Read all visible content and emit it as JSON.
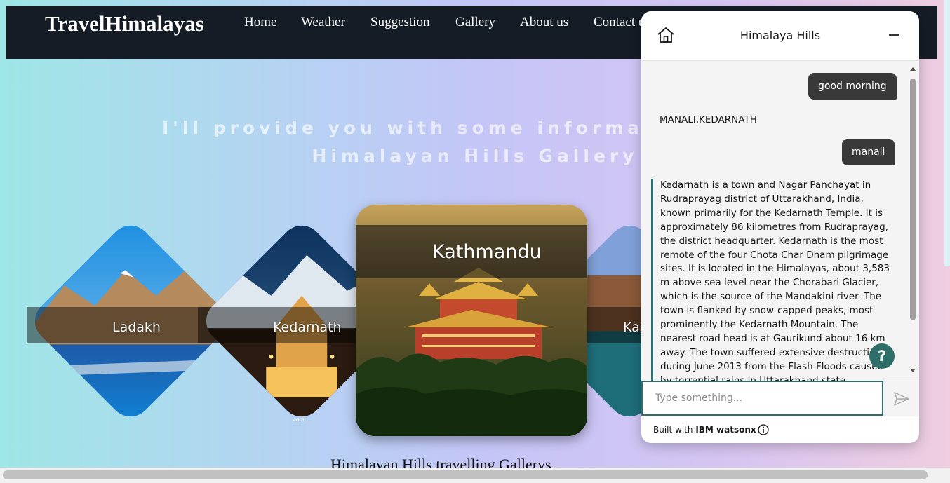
{
  "site": {
    "brand": "TravelHimalayas",
    "nav": [
      "Home",
      "Weather",
      "Suggestion",
      "Gallery",
      "About us",
      "Contact us"
    ]
  },
  "hero": {
    "line1": "I'll provide you with some information about",
    "line2": "Himalayan Hills Gallery"
  },
  "gallery": {
    "cards": [
      "Ladakh",
      "Kedarnath",
      "Kathmandu",
      "Kashmir"
    ],
    "watermark": "com",
    "caption": "Himalayan Hills travelling Gallerys"
  },
  "chat": {
    "title": "Himalaya Hills",
    "messages": [
      {
        "from": "user",
        "text": "good morning"
      },
      {
        "from": "bot",
        "text": "MANALI,KEDARNATH"
      },
      {
        "from": "user",
        "text": "manali"
      },
      {
        "from": "bot",
        "text": "Kedarnath is a town and Nagar Panchayat in Rudraprayag district of Uttarakhand, India, known primarily for the Kedarnath Temple. It is approximately 86 kilometres from Rudraprayag, the district headquarter. Kedarnath is the most remote of the four Chota Char Dham pilgrimage sites. It is located in the Himalayas, about 3,583 m above sea level near the Chorabari Glacier, which is the source of the Mandakini river. The town is flanked by snow-capped peaks, most prominently the Kedarnath Mountain. The nearest road head is at Gaurikund about 16 km away. The town suffered extensive destruction during June 2013 from the Flash Floods caused by torrential rains in Uttarakhand state."
      }
    ],
    "input_placeholder": "Type something...",
    "help_label": "?",
    "footer_prefix": "Built with ",
    "footer_brand": "IBM watsonx"
  },
  "icons": {
    "home": "home-icon",
    "minimize": "minimize-icon",
    "send": "send-icon",
    "info": "info-icon",
    "help": "help-icon"
  },
  "colors": {
    "navbar": "#161c26",
    "chat_accent": "#2d6e6e",
    "user_bubble": "#393939"
  }
}
